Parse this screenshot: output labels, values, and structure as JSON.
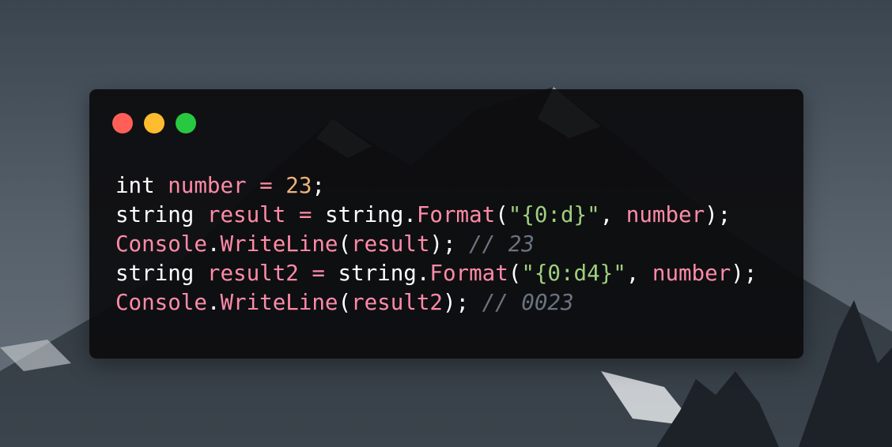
{
  "window": {
    "controls": [
      {
        "name": "close",
        "color": "#ff5f57"
      },
      {
        "name": "minimize",
        "color": "#febc2e"
      },
      {
        "name": "zoom",
        "color": "#28c840"
      }
    ]
  },
  "code": {
    "lines": [
      {
        "tokens": [
          {
            "text": "int",
            "type": "kw"
          },
          {
            "text": " ",
            "type": "ws"
          },
          {
            "text": "number",
            "type": "var"
          },
          {
            "text": " ",
            "type": "ws"
          },
          {
            "text": "=",
            "type": "op"
          },
          {
            "text": " ",
            "type": "ws"
          },
          {
            "text": "23",
            "type": "num"
          },
          {
            "text": ";",
            "type": "ident"
          }
        ]
      },
      {
        "tokens": [
          {
            "text": "string",
            "type": "kw"
          },
          {
            "text": " ",
            "type": "ws"
          },
          {
            "text": "result",
            "type": "var"
          },
          {
            "text": " ",
            "type": "ws"
          },
          {
            "text": "=",
            "type": "op"
          },
          {
            "text": " ",
            "type": "ws"
          },
          {
            "text": "string",
            "type": "ident"
          },
          {
            "text": ".",
            "type": "ident"
          },
          {
            "text": "Format",
            "type": "fn"
          },
          {
            "text": "(",
            "type": "ident"
          },
          {
            "text": "\"{0:d}\"",
            "type": "str"
          },
          {
            "text": ", ",
            "type": "ident"
          },
          {
            "text": "number",
            "type": "var"
          },
          {
            "text": ");",
            "type": "ident"
          }
        ]
      },
      {
        "tokens": [
          {
            "text": "Console",
            "type": "fn"
          },
          {
            "text": ".",
            "type": "ident"
          },
          {
            "text": "WriteLine",
            "type": "fn"
          },
          {
            "text": "(",
            "type": "ident"
          },
          {
            "text": "result",
            "type": "var"
          },
          {
            "text": "); ",
            "type": "ident"
          },
          {
            "text": "// 23",
            "type": "cm"
          }
        ]
      },
      {
        "tokens": [
          {
            "text": "string",
            "type": "kw"
          },
          {
            "text": " ",
            "type": "ws"
          },
          {
            "text": "result2",
            "type": "var"
          },
          {
            "text": " ",
            "type": "ws"
          },
          {
            "text": "=",
            "type": "op"
          },
          {
            "text": " ",
            "type": "ws"
          },
          {
            "text": "string",
            "type": "ident"
          },
          {
            "text": ".",
            "type": "ident"
          },
          {
            "text": "Format",
            "type": "fn"
          },
          {
            "text": "(",
            "type": "ident"
          },
          {
            "text": "\"{0:d4}\"",
            "type": "str"
          },
          {
            "text": ", ",
            "type": "ident"
          },
          {
            "text": "number",
            "type": "var"
          },
          {
            "text": ");",
            "type": "ident"
          }
        ]
      },
      {
        "tokens": [
          {
            "text": "Console",
            "type": "fn"
          },
          {
            "text": ".",
            "type": "ident"
          },
          {
            "text": "WriteLine",
            "type": "fn"
          },
          {
            "text": "(",
            "type": "ident"
          },
          {
            "text": "result2",
            "type": "var"
          },
          {
            "text": "); ",
            "type": "ident"
          },
          {
            "text": "// 0023",
            "type": "cm"
          }
        ]
      }
    ]
  },
  "theme": {
    "window_background": "#0c0c0e",
    "keyword": "#ffffff",
    "variable": "#ff8ba7",
    "number": "#f0b27a",
    "string": "#9fcf7f",
    "comment": "#6b7380"
  }
}
